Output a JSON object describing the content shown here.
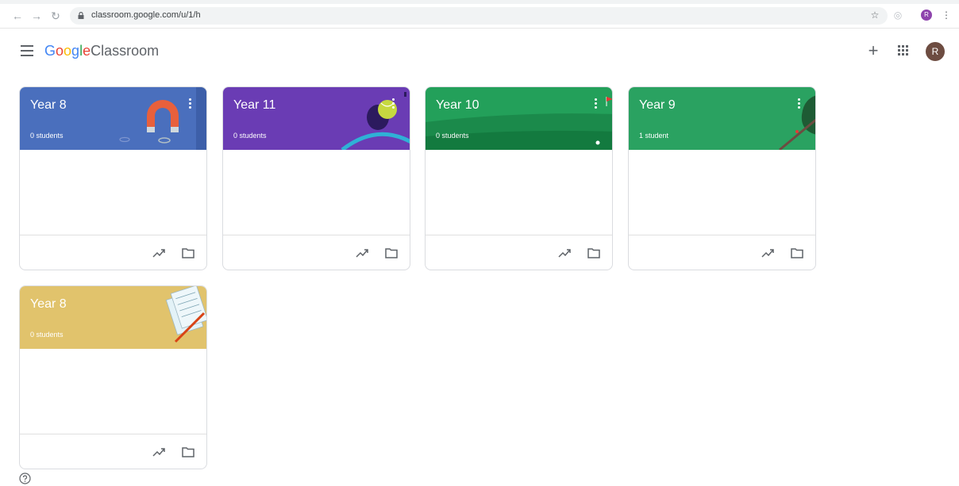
{
  "browser": {
    "url": "classroom.google.com/u/1/h",
    "profile_initial": "R",
    "icons": [
      "back-icon",
      "forward-icon",
      "reload-icon",
      "lock-icon",
      "star-icon",
      "extension-icon",
      "menu-icon"
    ]
  },
  "app": {
    "logo_google": "Google",
    "logo_product": "Classroom",
    "account_initial": "R",
    "icons": [
      "hamburger-icon",
      "plus-icon",
      "apps-grid-icon"
    ]
  },
  "classes": [
    {
      "title": "Year 8",
      "students": "0 students",
      "theme": "#4a6fbd",
      "illustration": "magnet"
    },
    {
      "title": "Year 11",
      "students": "0 students",
      "theme": "#6a3cb4",
      "illustration": "tennis-ball"
    },
    {
      "title": "Year 10",
      "students": "0 students",
      "theme": "#23a05a",
      "illustration": "golf-course"
    },
    {
      "title": "Year 9",
      "students": "1 student",
      "theme": "#2aa261",
      "illustration": "tree"
    },
    {
      "title": "Year 8",
      "students": "0 students",
      "theme": "#e1c36c",
      "illustration": "sheet-music"
    }
  ],
  "footer": {
    "icon": "help-icon"
  }
}
